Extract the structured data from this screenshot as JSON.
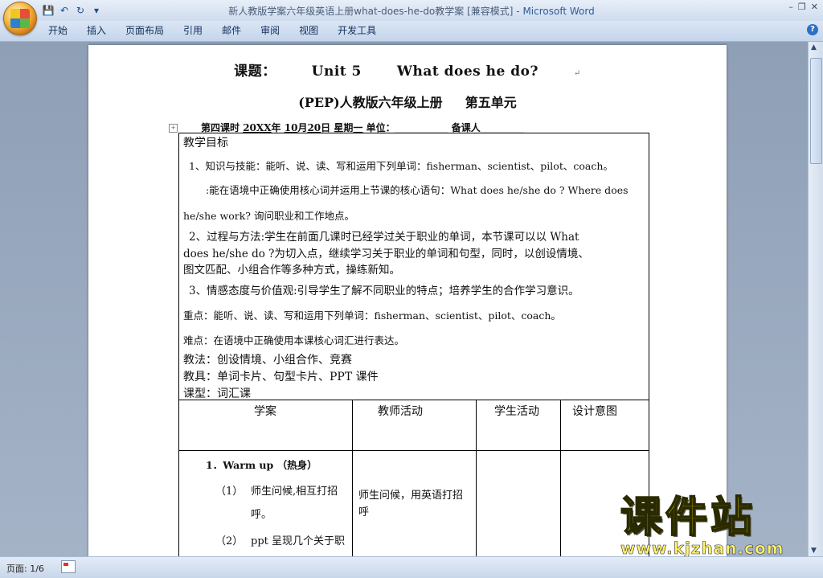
{
  "window": {
    "title": "新人教版学案六年级英语上册what-does-he-do教学案 [兼容模式]",
    "app_name": "Microsoft Word"
  },
  "ribbon_tabs": [
    "开始",
    "插入",
    "页面布局",
    "引用",
    "邮件",
    "审阅",
    "视图",
    "开发工具"
  ],
  "quick_access": [
    "save-icon",
    "undo-icon",
    "redo-icon",
    "customize-icon"
  ],
  "doc": {
    "title_prefix": "课题：",
    "title_unit": "Unit 5",
    "title_question": "What does he do?",
    "subtitle_left": "(PEP)人教版六年级上册",
    "subtitle_right": "第五单元",
    "meta": {
      "lesson": "第四课时",
      "year": "20XX",
      "year_suffix": "年",
      "month": "10",
      "month_suffix": "月",
      "day": "20",
      "day_suffix": "日",
      "weekday_label": "星期",
      "weekday": "一",
      "unit_label": "单位：",
      "unit_blank": "___________",
      "teacher_label": "备课人",
      "teacher_blank": "_________"
    },
    "objectives": {
      "heading": "教学目标",
      "l1": "1、知识与技能：能听、说、读、写和运用下列单词：fisherman、scientist、pilot、coach。",
      "l2": ":能在语境中正确使用核心词并运用上节课的核心语句：What does he/she do ? Where does",
      "l3": "he/she work?  询问职业和工作地点。",
      "l4": "2、过程与方法:学生在前面几课时已经学过关于职业的单词，本节课可以以 What",
      "l5": "does he/she do ?为切入点，继续学习关于职业的单词和句型，同时，以创设情境、",
      "l6": "图文匹配、小组合作等多种方式，操练新知。",
      "l7": "3、情感态度与价值观:引导学生了解不同职业的特点；培养学生的合作学习意识。",
      "key": "重点：能听、说、读、写和运用下列单词：fisherman、scientist、pilot、coach。",
      "difficulty": "难点：在语境中正确使用本课核心词汇进行表达。",
      "method": "教法：创设情境、小组合作、竞赛",
      "tools": "教具：单词卡片、句型卡片、PPT 课件",
      "type": "课型：词汇课"
    },
    "columns": [
      "学案",
      "教师活动",
      "学生活动",
      "设计意图"
    ],
    "row1": {
      "step": "1．Warm up （热身）",
      "item1_num": "（1）",
      "item1_text": "师生问候,相互打招",
      "item1_cont": "呼。",
      "item2_num": "（2）",
      "item2_text": "ppt 呈现几个关于职",
      "teacher_l1": "师生问候，用英语打招",
      "teacher_l2": "呼"
    }
  },
  "status": {
    "page": "页面: 1/6"
  },
  "watermark": {
    "brand": "课件站",
    "url": "www.kjzhan.com"
  }
}
